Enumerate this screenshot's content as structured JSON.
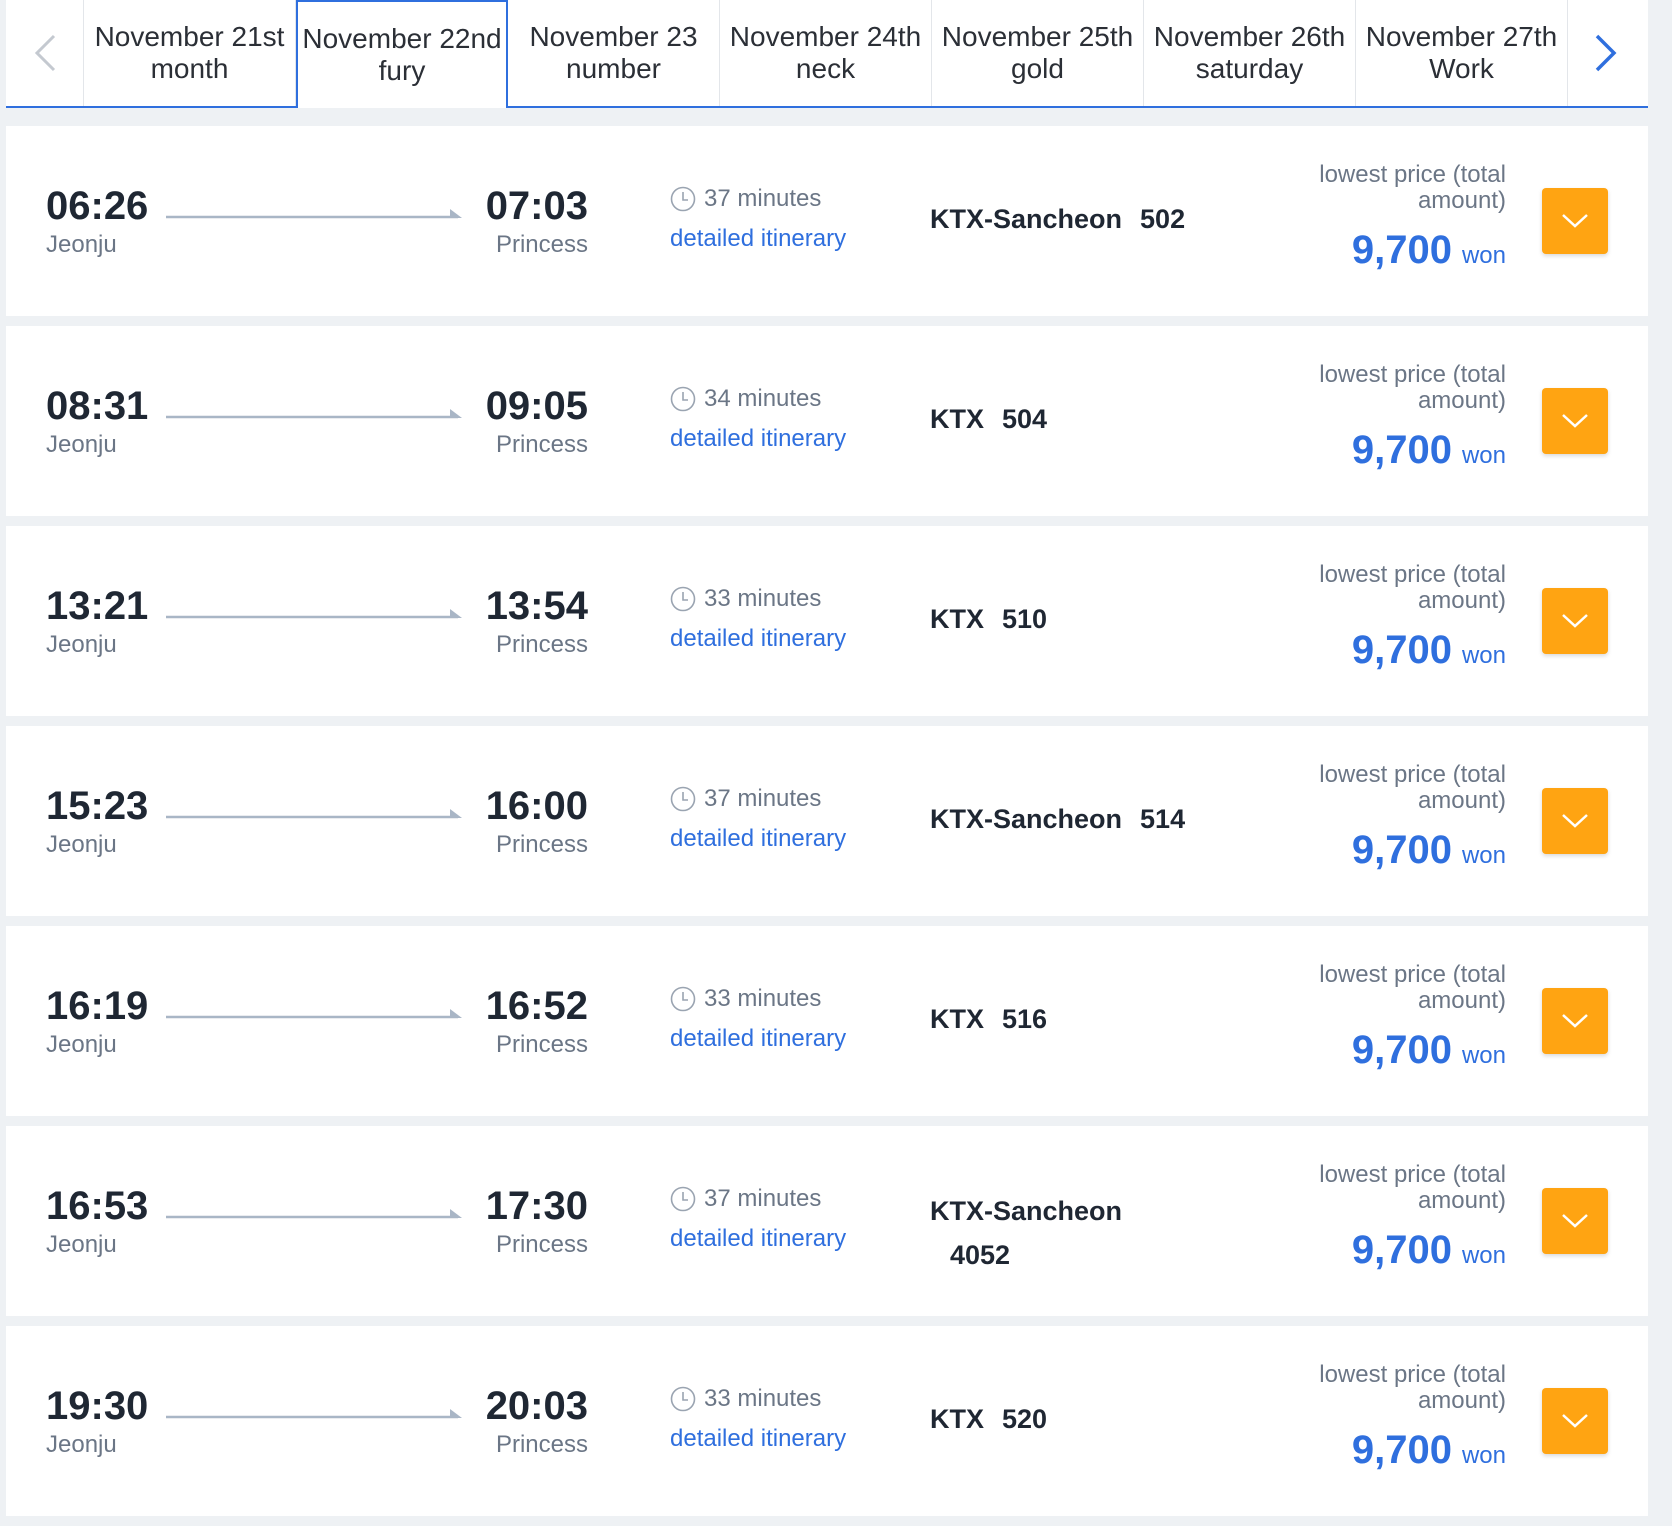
{
  "date_tabs": [
    {
      "date": "November 21st",
      "day": "month"
    },
    {
      "date": "November 22nd",
      "day": "fury"
    },
    {
      "date": "November 23",
      "day": "number"
    },
    {
      "date": "November 24th",
      "day": "neck"
    },
    {
      "date": "November 25th",
      "day": "gold"
    },
    {
      "date": "November 26th",
      "day": "saturday"
    },
    {
      "date": "November 27th",
      "day": "Work"
    }
  ],
  "active_tab": "November 22nd",
  "colors": {
    "accent": "#2f6fde",
    "button": "#ffa412",
    "line": "#a9b6c6"
  },
  "trains": [
    {
      "dep_time": "06:26",
      "dep_station": "Jeonju",
      "arr_time": "07:03",
      "arr_station": "Princess",
      "duration": "37 minutes",
      "itinerary_link": "detailed itinerary",
      "train_type": "KTX-Sancheon",
      "train_number": "502",
      "price_label": "lowest price (total amount)",
      "price": "9,700",
      "currency": "won"
    },
    {
      "dep_time": "08:31",
      "dep_station": "Jeonju",
      "arr_time": "09:05",
      "arr_station": "Princess",
      "duration": "34 minutes",
      "itinerary_link": "detailed itinerary",
      "train_type": "KTX",
      "train_number": "504",
      "price_label": "lowest price (total amount)",
      "price": "9,700",
      "currency": "won"
    },
    {
      "dep_time": "13:21",
      "dep_station": "Jeonju",
      "arr_time": "13:54",
      "arr_station": "Princess",
      "duration": "33 minutes",
      "itinerary_link": "detailed itinerary",
      "train_type": "KTX",
      "train_number": "510",
      "price_label": "lowest price (total amount)",
      "price": "9,700",
      "currency": "won"
    },
    {
      "dep_time": "15:23",
      "dep_station": "Jeonju",
      "arr_time": "16:00",
      "arr_station": "Princess",
      "duration": "37 minutes",
      "itinerary_link": "detailed itinerary",
      "train_type": "KTX-Sancheon",
      "train_number": "514",
      "price_label": "lowest price (total amount)",
      "price": "9,700",
      "currency": "won"
    },
    {
      "dep_time": "16:19",
      "dep_station": "Jeonju",
      "arr_time": "16:52",
      "arr_station": "Princess",
      "duration": "33 minutes",
      "itinerary_link": "detailed itinerary",
      "train_type": "KTX",
      "train_number": "516",
      "price_label": "lowest price (total amount)",
      "price": "9,700",
      "currency": "won"
    },
    {
      "dep_time": "16:53",
      "dep_station": "Jeonju",
      "arr_time": "17:30",
      "arr_station": "Princess",
      "duration": "37 minutes",
      "itinerary_link": "detailed itinerary",
      "train_type": "KTX-Sancheon",
      "train_number": "4052",
      "price_label": "lowest price (total amount)",
      "price": "9,700",
      "currency": "won"
    },
    {
      "dep_time": "19:30",
      "dep_station": "Jeonju",
      "arr_time": "20:03",
      "arr_station": "Princess",
      "duration": "33 minutes",
      "itinerary_link": "detailed itinerary",
      "train_type": "KTX",
      "train_number": "520",
      "price_label": "lowest price (total amount)",
      "price": "9,700",
      "currency": "won"
    }
  ]
}
